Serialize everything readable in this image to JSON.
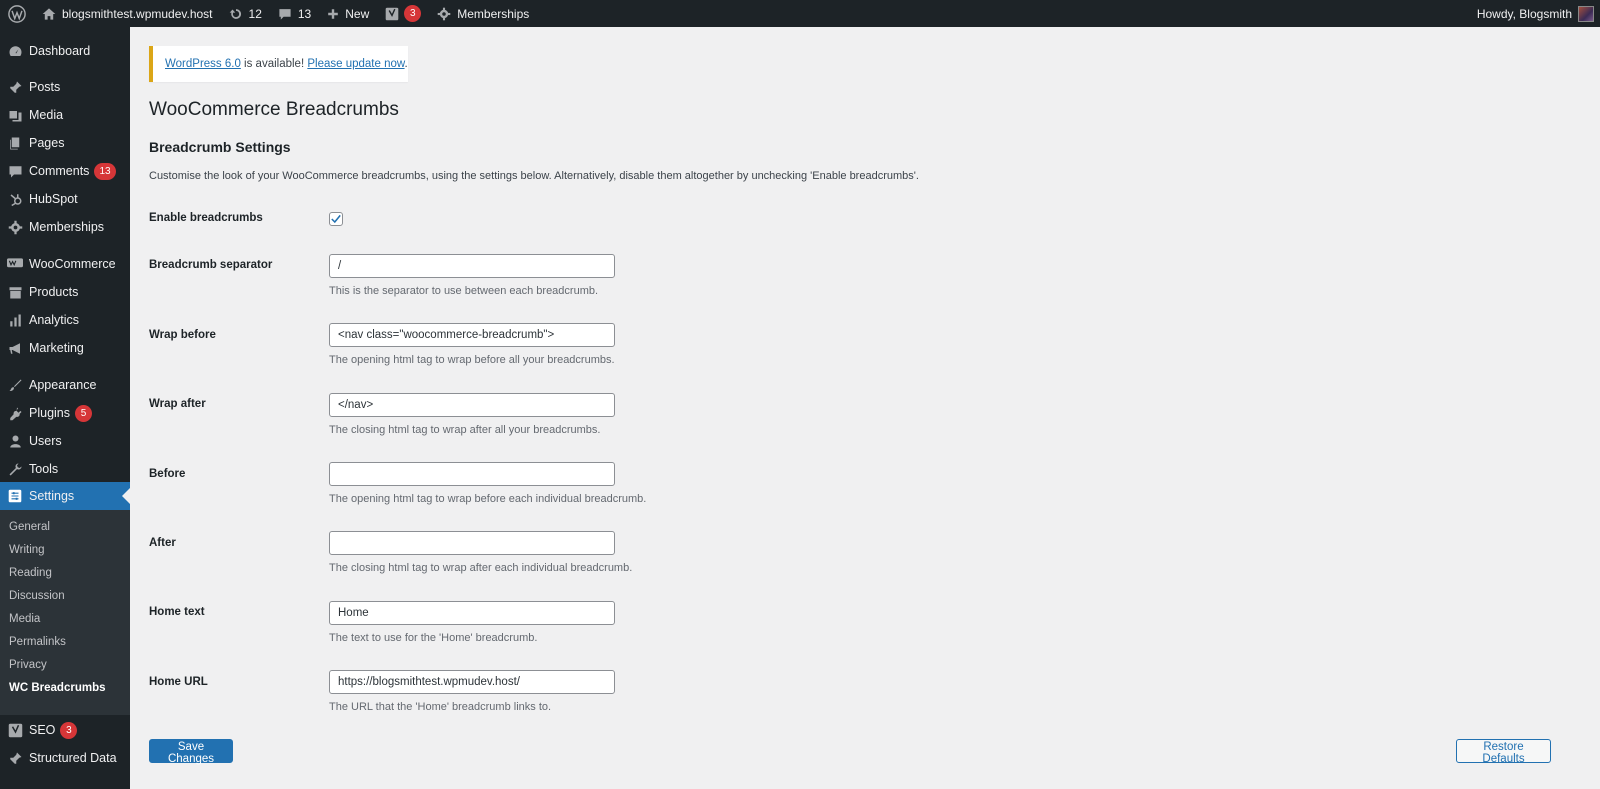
{
  "adminbar": {
    "site_name": "blogsmithtest.wpmudev.host",
    "updates_count": "12",
    "comments_count": "13",
    "new_label": "New",
    "seo_badge": "3",
    "memberships_label": "Memberships",
    "howdy": "Howdy, Blogsmith"
  },
  "sidebar": {
    "items": [
      {
        "label": "Dashboard",
        "icon": "dashboard-icon"
      },
      {
        "label": "Posts",
        "icon": "pin-icon"
      },
      {
        "label": "Media",
        "icon": "media-icon"
      },
      {
        "label": "Pages",
        "icon": "pages-icon"
      },
      {
        "label": "Comments",
        "icon": "comment-icon",
        "badge": "13"
      },
      {
        "label": "HubSpot",
        "icon": "hubspot-icon"
      },
      {
        "label": "Memberships",
        "icon": "gear-icon"
      },
      {
        "label": "WooCommerce",
        "icon": "woo-icon"
      },
      {
        "label": "Products",
        "icon": "archive-icon"
      },
      {
        "label": "Analytics",
        "icon": "bar-chart-icon"
      },
      {
        "label": "Marketing",
        "icon": "megaphone-icon"
      },
      {
        "label": "Appearance",
        "icon": "brush-icon"
      },
      {
        "label": "Plugins",
        "icon": "plug-icon",
        "badge": "5"
      },
      {
        "label": "Users",
        "icon": "user-icon"
      },
      {
        "label": "Tools",
        "icon": "wrench-icon"
      },
      {
        "label": "Settings",
        "icon": "settings-icon"
      },
      {
        "label": "SEO",
        "icon": "yoast-icon",
        "badge": "3"
      },
      {
        "label": "Structured Data",
        "icon": "pin-icon"
      }
    ],
    "submenu": [
      "General",
      "Writing",
      "Reading",
      "Discussion",
      "Media",
      "Permalinks",
      "Privacy",
      "WC Breadcrumbs"
    ]
  },
  "notice": {
    "link1": "WordPress 6.0",
    "middle": " is available! ",
    "link2": "Please update now",
    "end": "."
  },
  "page_title": "WooCommerce Breadcrumbs",
  "section_title": "Breadcrumb Settings",
  "section_desc": "Customise the look of your WooCommerce breadcrumbs, using the settings below. Alternatively, disable them altogether by unchecking 'Enable breadcrumbs'.",
  "fields": {
    "enable": {
      "label": "Enable breadcrumbs",
      "checked": true
    },
    "separator": {
      "label": "Breadcrumb separator",
      "value": "/",
      "hint": "This is the separator to use between each breadcrumb."
    },
    "wrap_before": {
      "label": "Wrap before",
      "value": "<nav class=\"woocommerce-breadcrumb\">",
      "hint": "The opening html tag to wrap before all your breadcrumbs."
    },
    "wrap_after": {
      "label": "Wrap after",
      "value": "</nav>",
      "hint": "The closing html tag to wrap after all your breadcrumbs."
    },
    "before": {
      "label": "Before",
      "value": "",
      "hint": "The opening html tag to wrap before each individual breadcrumb."
    },
    "after": {
      "label": "After",
      "value": "",
      "hint": "The closing html tag to wrap after each individual breadcrumb."
    },
    "home_text": {
      "label": "Home text",
      "value": "Home",
      "hint": "The text to use for the 'Home' breadcrumb."
    },
    "home_url": {
      "label": "Home URL",
      "value": "https://blogsmithtest.wpmudev.host/",
      "hint": "The URL that the 'Home' breadcrumb links to."
    }
  },
  "buttons": {
    "save": "Save Changes",
    "restore": "Restore Defaults"
  },
  "colors": {
    "accent": "#2271b1",
    "sidebar": "#1d2327",
    "badge": "#d63638",
    "notice_border": "#dba617"
  }
}
